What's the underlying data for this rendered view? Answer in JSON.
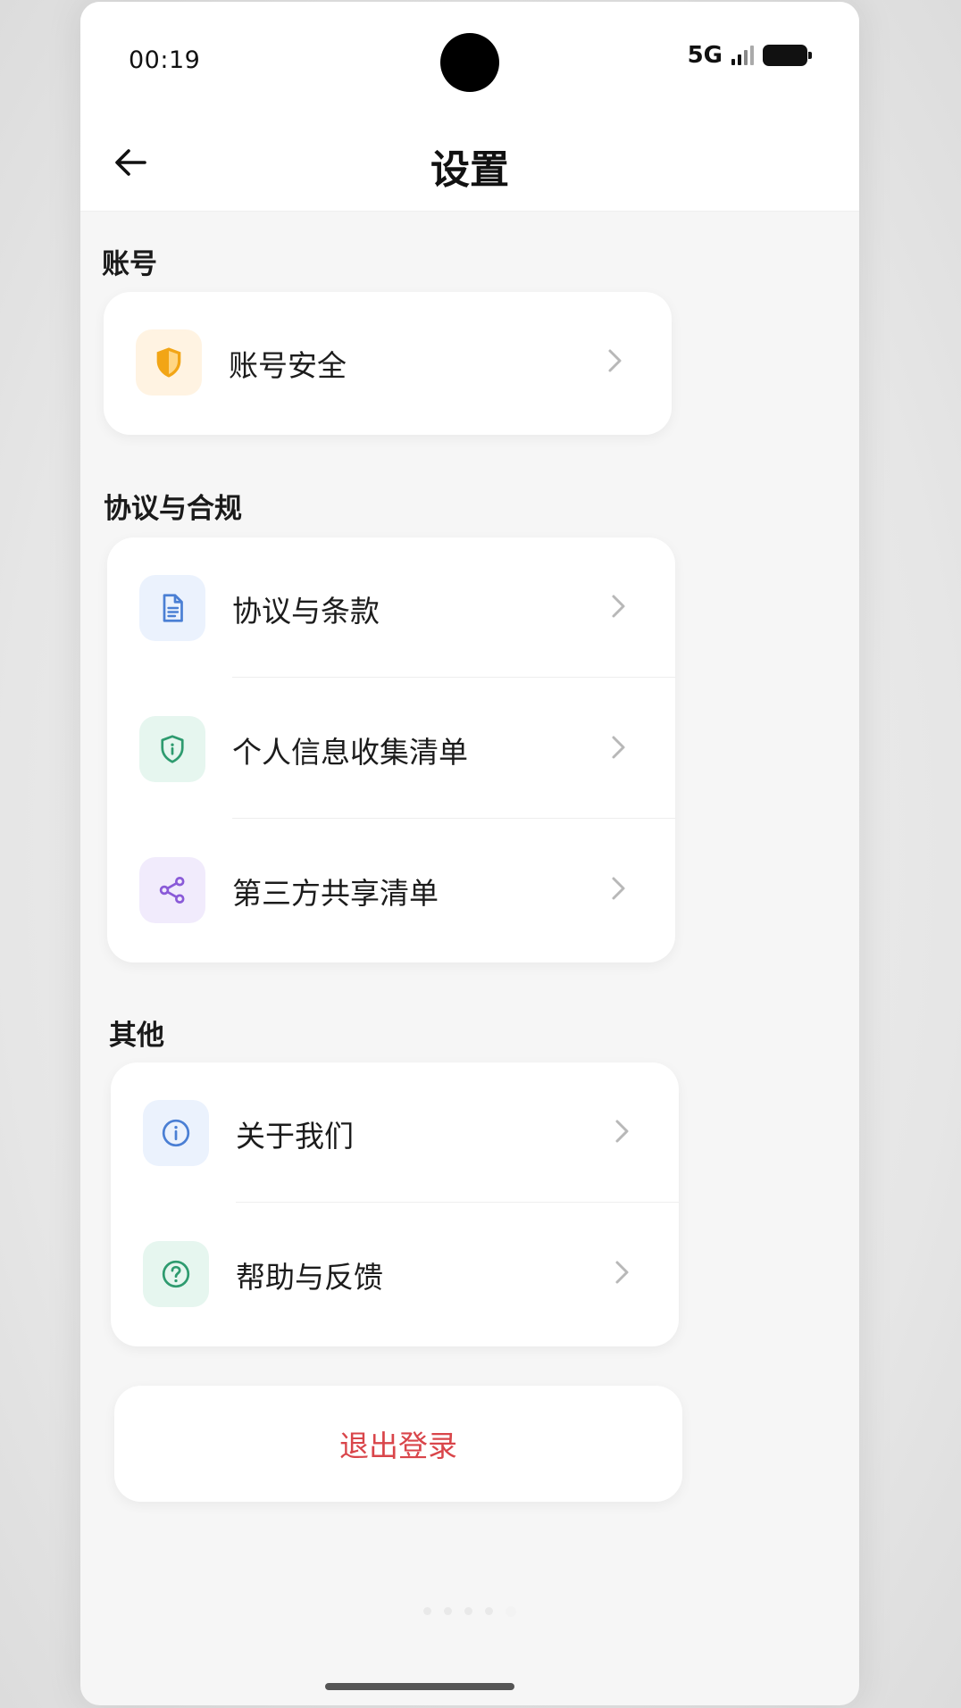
{
  "status_bar": {
    "time": "00:19",
    "network": "5G"
  },
  "nav": {
    "title": "设置"
  },
  "sections": {
    "account": {
      "title": "账号",
      "items": [
        {
          "label": "账号安全",
          "icon": "shield-check-icon",
          "icon_color": "#f2a516",
          "icon_bg": "#fff3e2"
        }
      ]
    },
    "compliance": {
      "title": "协议与合规",
      "items": [
        {
          "label": "协议与条款",
          "icon": "document-icon",
          "icon_color": "#4a7fd4",
          "icon_bg": "#ebf2fd"
        },
        {
          "label": "个人信息收集清单",
          "icon": "shield-info-icon",
          "icon_color": "#2e9b6f",
          "icon_bg": "#e6f6ef"
        },
        {
          "label": "第三方共享清单",
          "icon": "share-icon",
          "icon_color": "#8a5ad8",
          "icon_bg": "#f1ebfc"
        }
      ]
    },
    "other": {
      "title": "其他",
      "items": [
        {
          "label": "关于我们",
          "icon": "info-icon",
          "icon_color": "#4a7fd4",
          "icon_bg": "#ebf2fd"
        },
        {
          "label": "帮助与反馈",
          "icon": "help-icon",
          "icon_color": "#2e9b6f",
          "icon_bg": "#e6f6ef"
        }
      ]
    }
  },
  "logout": {
    "label": "退出登录",
    "color": "#d9454a"
  }
}
